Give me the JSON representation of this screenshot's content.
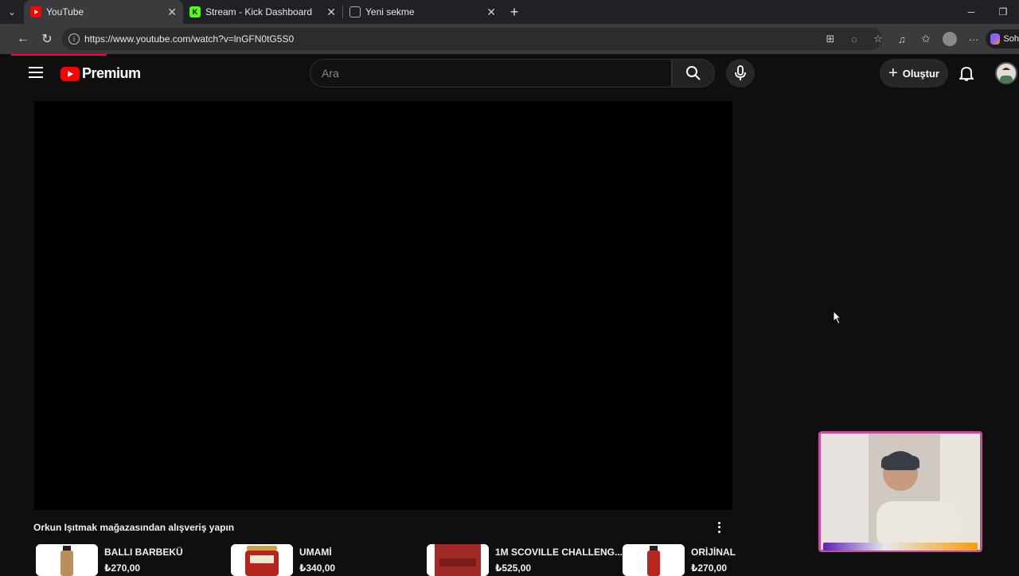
{
  "browser": {
    "tabs": [
      {
        "title": "YouTube",
        "active": true,
        "favicon": "youtube-icon"
      },
      {
        "title": "Stream - Kick Dashboard",
        "active": false,
        "favicon": "kick-icon"
      },
      {
        "title": "Yeni sekme",
        "active": false,
        "favicon": "new-tab-page-icon"
      }
    ],
    "url": "https://www.youtube.com/watch?v=lnGFN0tG5S0",
    "sidebar_button": "Soh"
  },
  "youtube": {
    "logo_text": "Premium",
    "search_placeholder": "Ara",
    "create_label": "Oluştur"
  },
  "store": {
    "title": "Orkun Işıtmak mağazasından alışveriş yapın",
    "products": [
      {
        "name": "BALLI BARBEKÜ",
        "price": "₺270,00"
      },
      {
        "name": "UMAMİ",
        "price": "₺340,00"
      },
      {
        "name": "1M SCOVILLE CHALLENG...",
        "price": "₺525,00"
      },
      {
        "name": "ORİJİNAL",
        "price": "₺270,00"
      }
    ]
  },
  "colors": {
    "accent": "#ff0000",
    "page_bg": "#0f0f0f",
    "webcam_border": "#c94ca0"
  }
}
